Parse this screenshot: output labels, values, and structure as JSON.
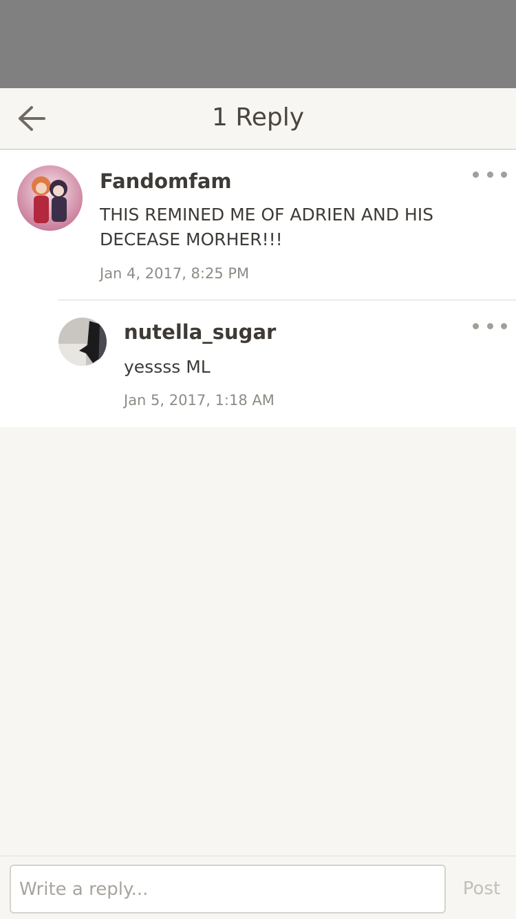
{
  "header": {
    "title": "1 Reply",
    "back_icon": "arrow-left-icon"
  },
  "comment": {
    "username": "Fandomfam",
    "text": "THIS REMINED ME OF ADRIEN AND HIS DECEASE MORHER!!!",
    "timestamp": "Jan 4, 2017, 8:25 PM",
    "more_icon": "more-horizontal-icon"
  },
  "reply": {
    "username": "nutella_sugar",
    "text": "yessss ML",
    "timestamp": "Jan 5, 2017, 1:18 AM",
    "more_icon": "more-horizontal-icon"
  },
  "reply_bar": {
    "placeholder": "Write a reply...",
    "post_label": "Post"
  },
  "colors": {
    "status_area": "#808080",
    "background": "#f7f6f2",
    "text": "#3e3a36",
    "muted": "#8f8a84",
    "post_disabled": "#c3bfb9"
  }
}
